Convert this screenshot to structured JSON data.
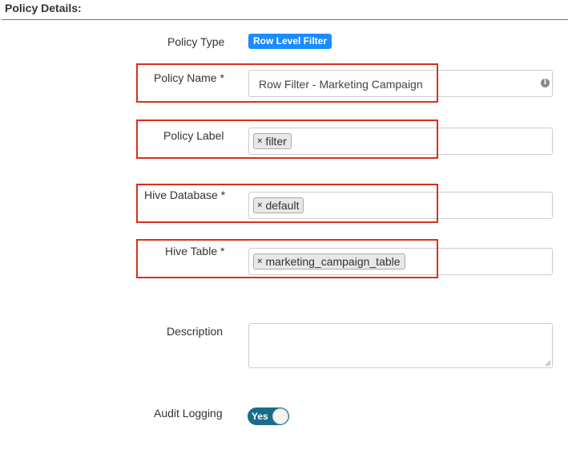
{
  "section": {
    "title": "Policy Details:"
  },
  "fields": {
    "policy_type": {
      "label": "Policy Type",
      "value": "Row Level Filter"
    },
    "policy_name": {
      "label": "Policy Name *",
      "value": "Row Filter - Marketing Campaign",
      "info_icon": "info-icon"
    },
    "policy_label": {
      "label": "Policy Label",
      "tags": [
        "filter"
      ]
    },
    "hive_database": {
      "label": "Hive Database *",
      "tags": [
        "default"
      ]
    },
    "hive_table": {
      "label": "Hive Table *",
      "tags": [
        "marketing_campaign_table"
      ]
    },
    "description": {
      "label": "Description",
      "value": ""
    },
    "audit_logging": {
      "label": "Audit Logging",
      "toggle_text": "Yes",
      "enabled": true
    }
  },
  "tag_remove_glyph": "×",
  "info_glyph": "i",
  "colors": {
    "badge": "#1a8cff",
    "toggle_on": "#1a6c8c",
    "highlight_box": "#d9301c",
    "section_rule": "#3a8a8a"
  }
}
